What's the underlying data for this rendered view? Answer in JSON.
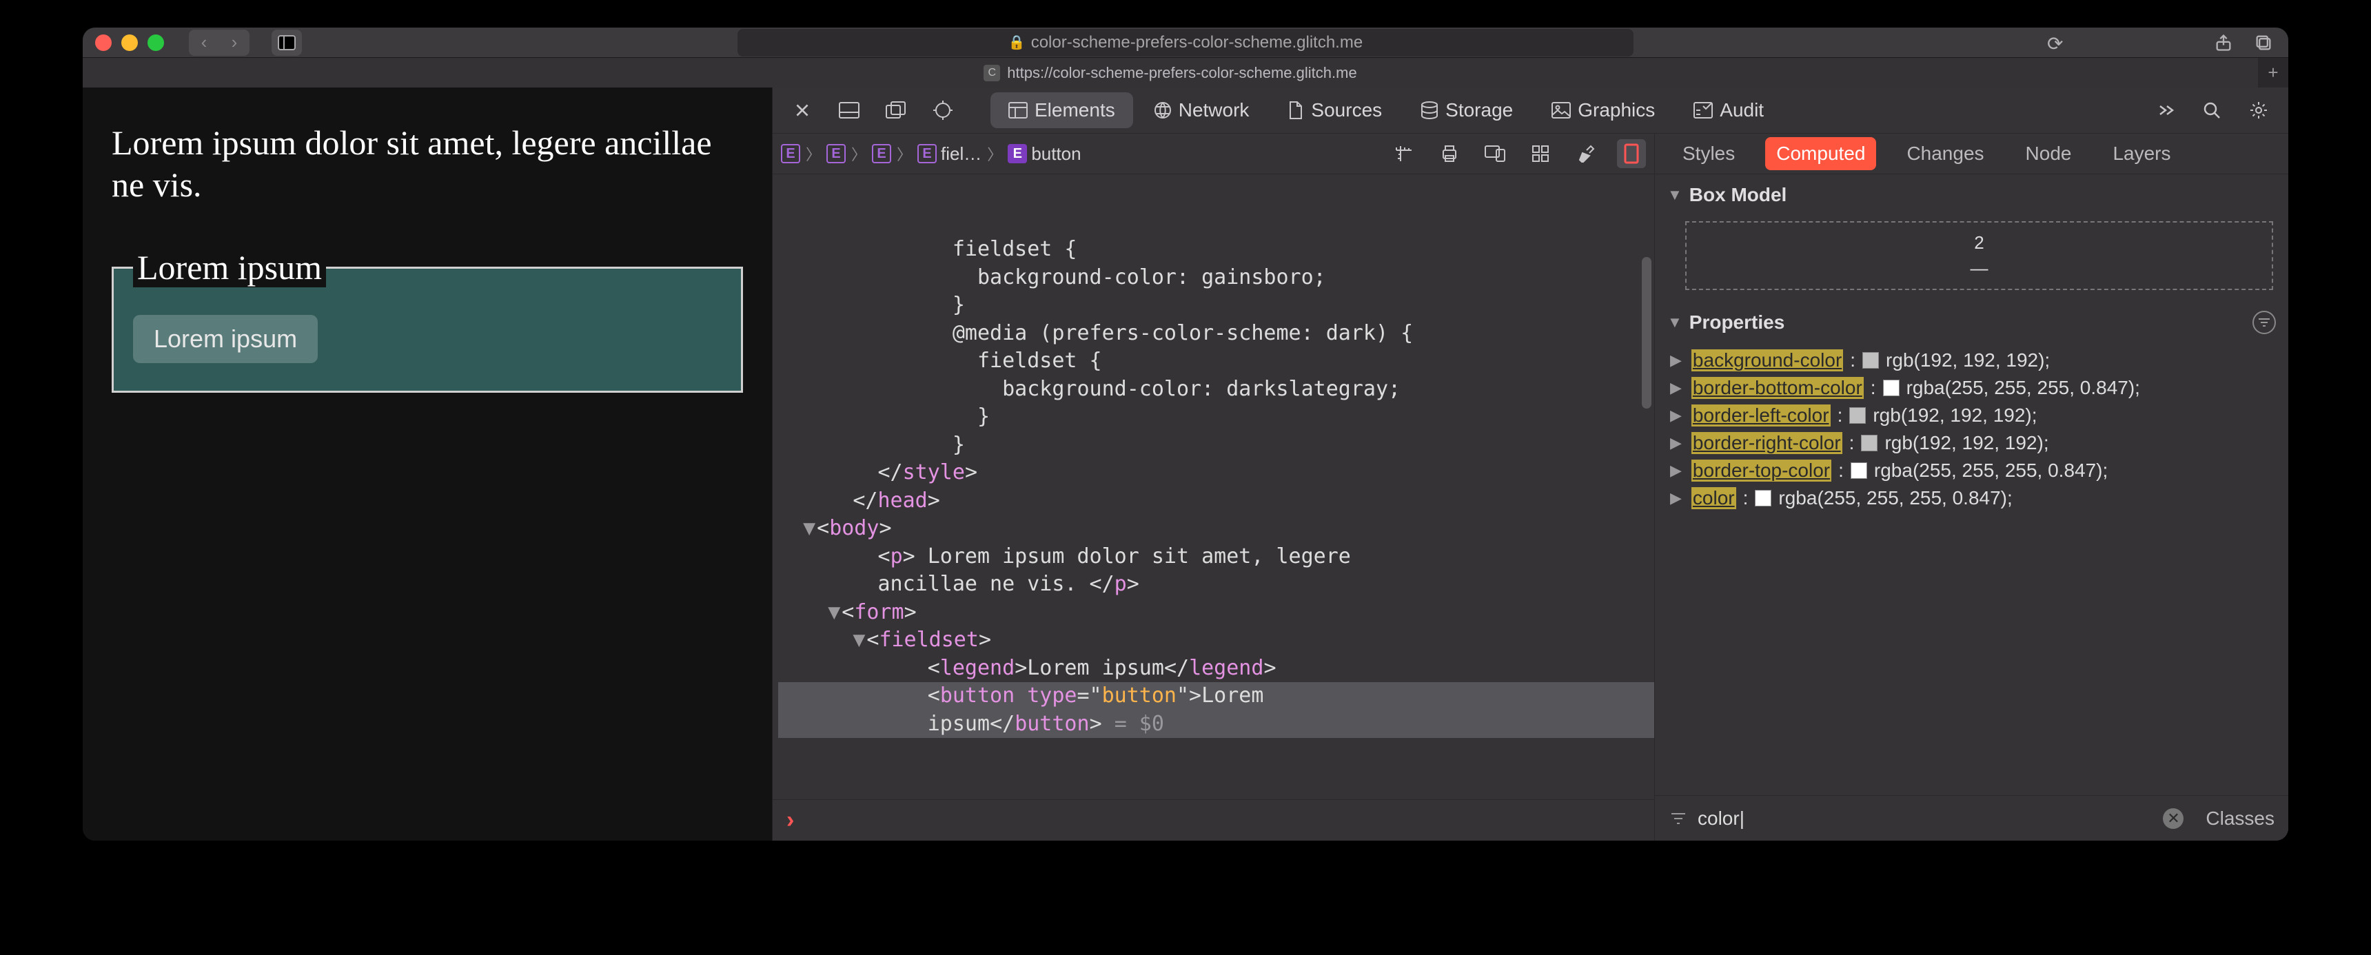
{
  "titlebar": {
    "url_display": "color-scheme-prefers-color-scheme.glitch.me"
  },
  "tab": {
    "favicon_letter": "C",
    "title": "https://color-scheme-prefers-color-scheme.glitch.me"
  },
  "page": {
    "paragraph": "Lorem ipsum dolor sit amet, legere ancillae ne vis.",
    "legend": "Lorem ipsum",
    "button_label": "Lorem ipsum"
  },
  "devtools": {
    "panels": [
      "Elements",
      "Network",
      "Sources",
      "Storage",
      "Graphics",
      "Audit"
    ],
    "active_panel": "Elements",
    "breadcrumb": [
      {
        "tag": "",
        "label": ""
      },
      {
        "tag": "",
        "label": ""
      },
      {
        "tag": "",
        "label": ""
      },
      {
        "tag": "",
        "label": "fiel…"
      },
      {
        "tag": "",
        "label": "button"
      }
    ],
    "dom_lines": [
      {
        "indent": 7,
        "text": "fieldset {"
      },
      {
        "indent": 8,
        "text": "background-color: gainsboro;"
      },
      {
        "indent": 7,
        "text": "}"
      },
      {
        "indent": 7,
        "text": "@media (prefers-color-scheme: dark) {"
      },
      {
        "indent": 8,
        "text": "fieldset {"
      },
      {
        "indent": 9,
        "text": "background-color: darkslategray;"
      },
      {
        "indent": 8,
        "text": "}"
      },
      {
        "indent": 7,
        "text": "}"
      },
      {
        "indent": 4,
        "html": "&lt;/<span class='t-tag'>style</span>&gt;"
      },
      {
        "indent": 3,
        "html": "&lt;/<span class='t-tag'>head</span>&gt;"
      },
      {
        "indent": 2,
        "disclosure": "▼",
        "html": "&lt;<span class='t-tag'>body</span>&gt;"
      },
      {
        "indent": 4,
        "html": "&lt;<span class='t-tag'>p</span>&gt; <span class='t-text'>Lorem ipsum dolor sit amet, legere</span>"
      },
      {
        "indent": 4,
        "html": "<span class='t-text'>ancillae ne vis. </span>&lt;/<span class='t-tag'>p</span>&gt;"
      },
      {
        "indent": 3,
        "disclosure": "▼",
        "html": "&lt;<span class='t-tag'>form</span>&gt;"
      },
      {
        "indent": 4,
        "disclosure": "▼",
        "html": "&lt;<span class='t-tag'>fieldset</span>&gt;"
      },
      {
        "indent": 6,
        "html": "&lt;<span class='t-tag'>legend</span>&gt;<span class='t-text'>Lorem ipsum</span>&lt;/<span class='t-tag'>legend</span>&gt;"
      },
      {
        "indent": 6,
        "selected": true,
        "html": "&lt;<span class='t-tag'>button</span> <span class='t-attr'>type</span>=&quot;<span class='t-val'>button</span>&quot;&gt;<span class='t-text'>Lorem</span>"
      },
      {
        "indent": 6,
        "selected": true,
        "html": "<span class='t-text'>ipsum</span>&lt;/<span class='t-tag'>button</span>&gt; <span class='dom-dollar'>= $0</span>"
      }
    ]
  },
  "styles": {
    "tabs": [
      "Styles",
      "Computed",
      "Changes",
      "Node",
      "Layers"
    ],
    "active_tab": "Computed",
    "box_model_header": "Box Model",
    "box_top": "2",
    "box_dash": "—",
    "properties_header": "Properties",
    "props": [
      {
        "name": "background-color",
        "swatch": "#c0c0c0",
        "value": "rgb(192, 192, 192);"
      },
      {
        "name": "border-bottom-color",
        "swatch": "#ffffff",
        "value": "rgba(255, 255, 255, 0.847);",
        "wrap": true
      },
      {
        "name": "border-left-color",
        "swatch": "#c0c0c0",
        "value": "rgb(192, 192, 192);"
      },
      {
        "name": "border-right-color",
        "swatch": "#c0c0c0",
        "value": "rgb(192, 192, 192);"
      },
      {
        "name": "border-top-color",
        "swatch": "#ffffff",
        "value": "rgba(255, 255, 255, 0.847);"
      },
      {
        "name": "color",
        "swatch": "#ffffff",
        "value": "rgba(255, 255, 255, 0.847);"
      }
    ],
    "filter_value": "color",
    "classes_label": "Classes"
  }
}
